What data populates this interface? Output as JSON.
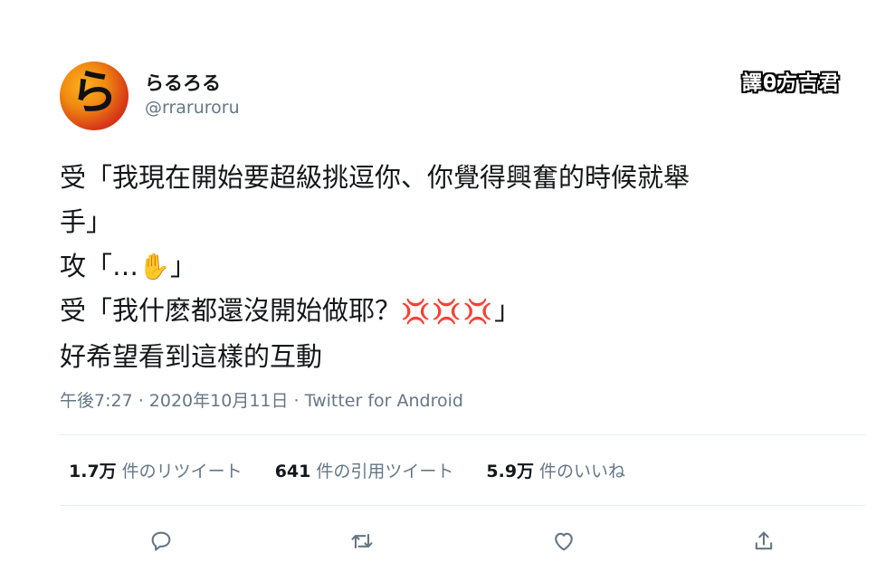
{
  "user": {
    "display_name": "らるろる",
    "handle": "@rraruroru",
    "avatar_text": "ら"
  },
  "watermark": "譯θ方吉君",
  "tweet": {
    "line1": "受「我現在開始要超級挑逗你、你覺得興奮的時候就舉",
    "line2": "手」",
    "line3_text": "攻「…",
    "line3_emoji": "✋",
    "line3_end": "」",
    "line4_text": "受「我什麽都還沒開始做耶？",
    "line4_emoji": "💢💢💢",
    "line4_end": "」",
    "line5": "好希望看到這樣的互動"
  },
  "meta": "午後7:27 · 2020年10月11日 · Twitter for Android",
  "stats": {
    "retweets_count": "1.7万",
    "retweets_label": "件のリツイート",
    "quotes_count": "641",
    "quotes_label": "件の引用ツイート",
    "likes_count": "5.9万",
    "likes_label": "件のいいね"
  },
  "actions": {
    "reply_icon": "reply-icon",
    "retweet_icon": "retweet-icon",
    "like_icon": "heart-icon",
    "share_icon": "share-icon"
  },
  "colors": {
    "secondary_text": "#657786",
    "divider": "#e6ecf0",
    "anger": "#c0152a"
  }
}
